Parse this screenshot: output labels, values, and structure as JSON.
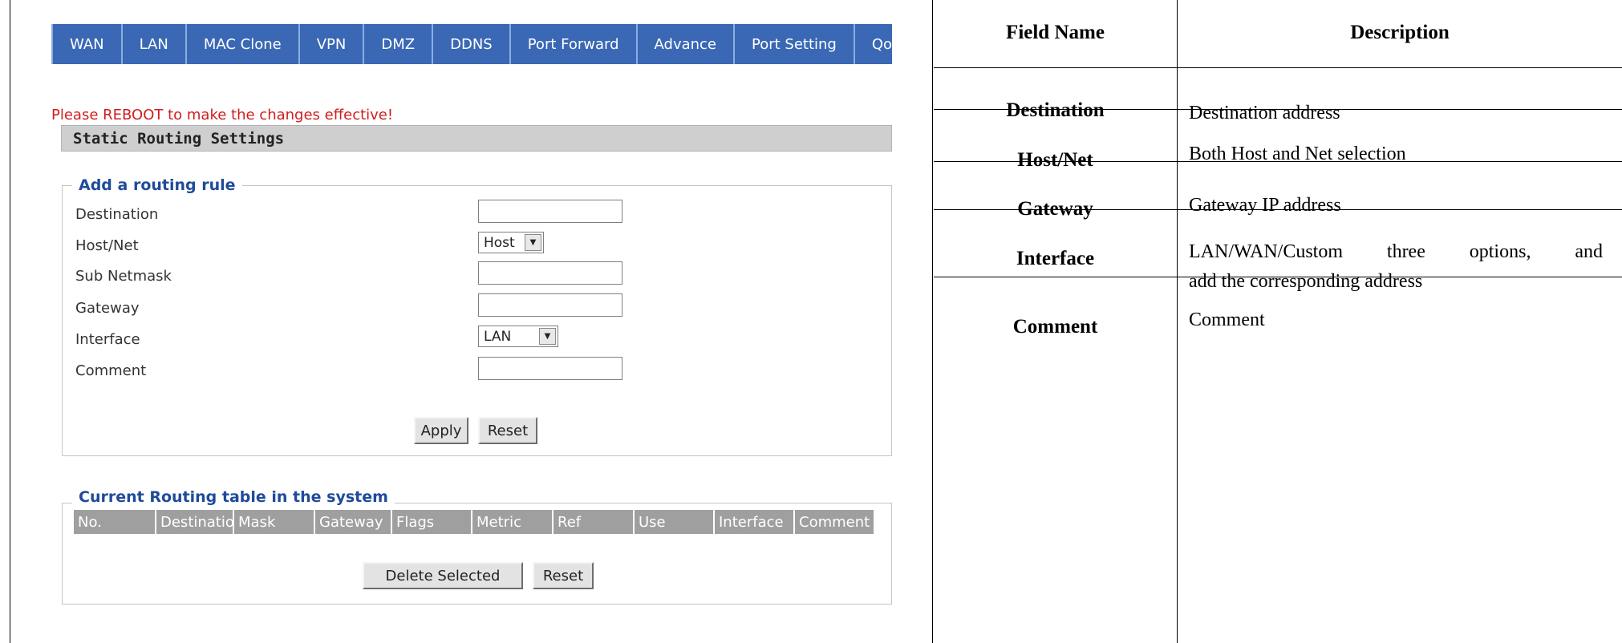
{
  "nav": {
    "tabs": [
      "WAN",
      "LAN",
      "MAC Clone",
      "VPN",
      "DMZ",
      "DDNS",
      "Port Forward",
      "Advance",
      "Port Setting",
      "QoS"
    ]
  },
  "notice": "Please REBOOT to make the changes effective!",
  "section_title": "Static Routing Settings",
  "rule_form": {
    "legend": "Add a routing rule",
    "fields": {
      "destination": {
        "label": "Destination",
        "value": ""
      },
      "hostnet": {
        "label": "Host/Net",
        "value": "Host"
      },
      "subnetmask": {
        "label": "Sub Netmask",
        "value": ""
      },
      "gateway": {
        "label": "Gateway",
        "value": ""
      },
      "interface": {
        "label": "Interface",
        "value": "LAN"
      },
      "comment": {
        "label": "Comment",
        "value": ""
      }
    },
    "apply_label": "Apply",
    "reset_label": "Reset"
  },
  "routing_table": {
    "legend": "Current Routing table in the system",
    "columns": [
      "No.",
      "Destination",
      "Mask",
      "Gateway",
      "Flags",
      "Metric",
      "Ref",
      "Use",
      "Interface",
      "Comment"
    ],
    "delete_label": "Delete Selected",
    "reset_label": "Reset"
  },
  "field_table": {
    "headers": {
      "name": "Field Name",
      "description": "Description"
    },
    "rows": [
      {
        "name": "Destination",
        "description": "Destination address"
      },
      {
        "name": "Host/Net",
        "description": "Both Host and Net selection"
      },
      {
        "name": "Gateway",
        "description": "Gateway IP address"
      },
      {
        "name": "Interface",
        "description_line1": "LAN/WAN/Custom three options, and",
        "description_line2": "add the corresponding address"
      },
      {
        "name": "Comment",
        "description": "Comment"
      }
    ]
  },
  "colors": {
    "nav_bg": "#3a68b5",
    "notice": "#d21c1c",
    "legend": "#1f4b9a",
    "table_header_bg": "#9f9f9f"
  }
}
